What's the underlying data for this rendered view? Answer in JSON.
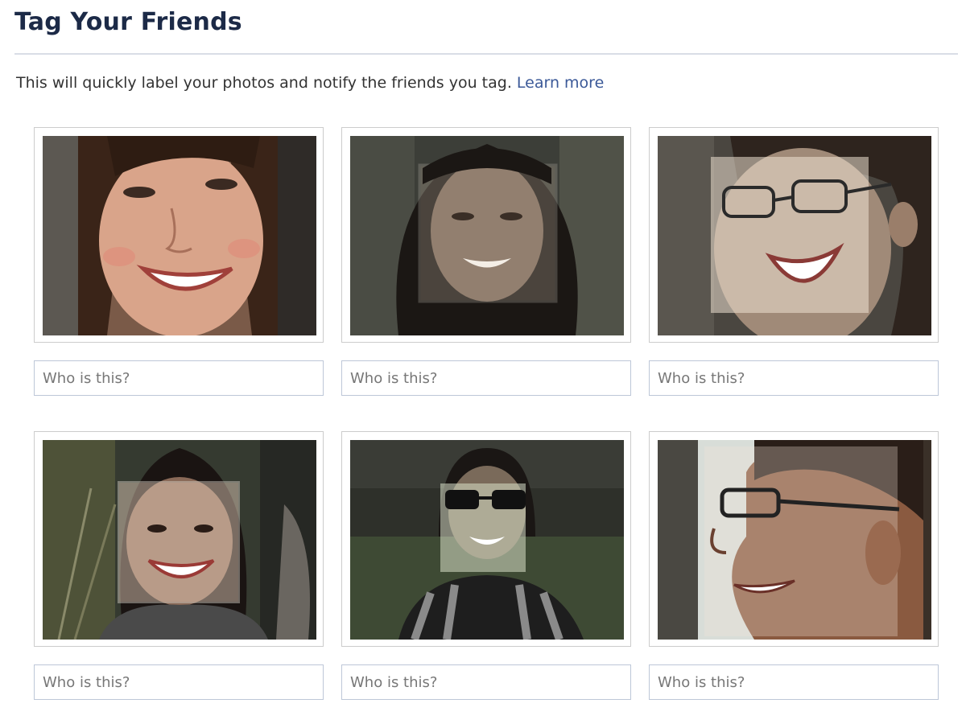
{
  "header": {
    "title": "Tag Your Friends"
  },
  "description": {
    "text": "This will quickly label your photos and notify the friends you tag.",
    "learn_more": "Learn more"
  },
  "colors": {
    "title": "#1c2a47",
    "link": "#3b5998",
    "input_border": "#bdc7d8",
    "frame_border": "#cccccc"
  },
  "faces": [
    {
      "placeholder": "Who is this?",
      "description_icon": "face-photo"
    },
    {
      "placeholder": "Who is this?",
      "description_icon": "face-photo"
    },
    {
      "placeholder": "Who is this?",
      "description_icon": "face-photo"
    },
    {
      "placeholder": "Who is this?",
      "description_icon": "face-photo"
    },
    {
      "placeholder": "Who is this?",
      "description_icon": "face-photo"
    },
    {
      "placeholder": "Who is this?",
      "description_icon": "face-photo"
    }
  ]
}
